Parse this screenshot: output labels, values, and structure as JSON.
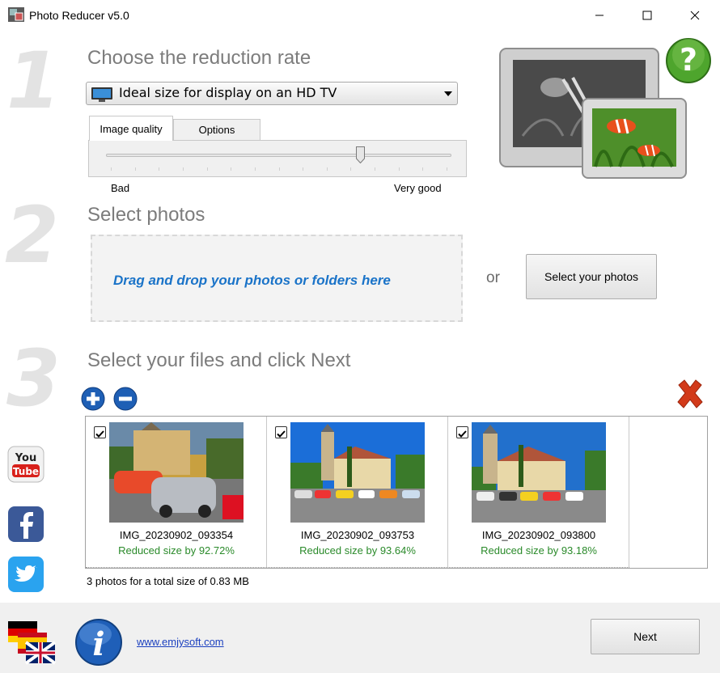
{
  "window": {
    "title": "Photo Reducer v5.0"
  },
  "steps": {
    "step1": {
      "number": "1",
      "heading": "Choose the reduction rate"
    },
    "step2": {
      "number": "2",
      "heading": "Select photos"
    },
    "step3": {
      "number": "3",
      "heading": "Select your files and click Next"
    }
  },
  "reduction": {
    "selected": "Ideal size for display on an HD TV",
    "tabs": [
      {
        "label": "Image quality",
        "active": true
      },
      {
        "label": "Options",
        "active": false
      }
    ],
    "quality_min_label": "Bad",
    "quality_max_label": "Very good",
    "quality_level": 0.75
  },
  "select": {
    "drop_text": "Drag and drop your photos or folders here",
    "or_text": "or",
    "button_label": "Select your photos"
  },
  "files": [
    {
      "name": "IMG_20230902_093354",
      "reduction": "Reduced size by 92.72%",
      "checked": true
    },
    {
      "name": "IMG_20230902_093753",
      "reduction": "Reduced size by 93.64%",
      "checked": true
    },
    {
      "name": "IMG_20230902_093800",
      "reduction": "Reduced size by 93.18%",
      "checked": true
    }
  ],
  "status": "3 photos for a total size of 0.83 MB",
  "footer": {
    "link": "www.emjysoft.com",
    "next_label": "Next"
  },
  "icons": {
    "help": "help-icon",
    "add": "add-icon",
    "remove": "remove-icon",
    "clear": "clear-list-icon",
    "info": "info-icon",
    "youtube": "youtube-icon",
    "facebook": "facebook-icon",
    "twitter": "twitter-icon",
    "language": "language-flags-icon"
  },
  "colors": {
    "heading": "#7c7c7c",
    "drop_text": "#1a73c8",
    "reduction_text": "#2a8a2a",
    "link": "#1a3fbf"
  }
}
